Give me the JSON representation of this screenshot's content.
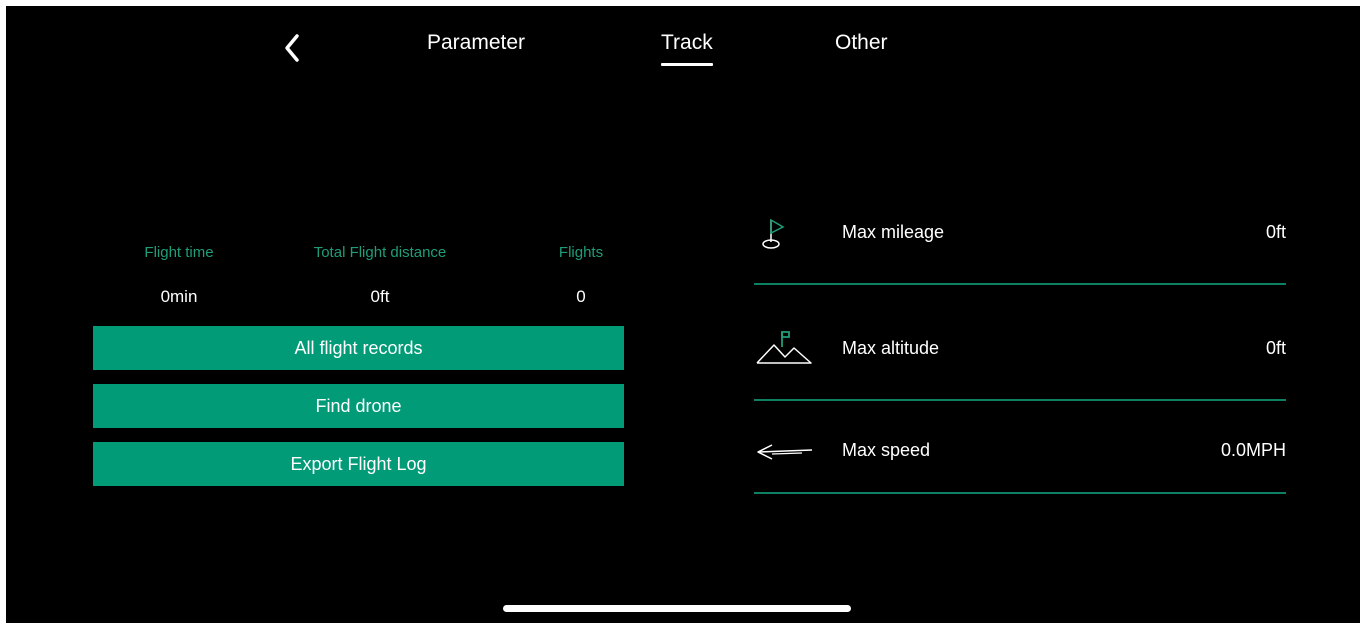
{
  "header": {
    "tabs": [
      {
        "label": "Parameter",
        "active": false
      },
      {
        "label": "Track",
        "active": true
      },
      {
        "label": "Other",
        "active": false
      }
    ],
    "back_icon": "chevron-left-icon"
  },
  "stats": [
    {
      "label": "Flight time",
      "value": "0min"
    },
    {
      "label": "Total Flight distance",
      "value": "0ft"
    },
    {
      "label": "Flights",
      "value": "0"
    }
  ],
  "actions": [
    {
      "label": "All flight records"
    },
    {
      "label": "Find drone"
    },
    {
      "label": "Export Flight Log"
    }
  ],
  "records": [
    {
      "icon": "flag-icon",
      "label": "Max mileage",
      "value": "0ft"
    },
    {
      "icon": "mountain-flag-icon",
      "label": "Max altitude",
      "value": "0ft"
    },
    {
      "icon": "arrow-speed-icon",
      "label": "Max speed",
      "value": "0.0MPH"
    }
  ],
  "colors": {
    "accent": "#019b77",
    "accent_text": "#1f9d79",
    "divider": "#0e7f63",
    "background": "#000000"
  }
}
